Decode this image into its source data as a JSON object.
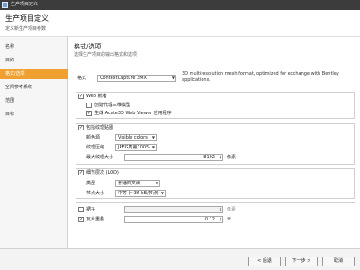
{
  "window": {
    "title": "生产项目定义"
  },
  "header": {
    "title": "生产项目定义",
    "subtitle": "定义新生产项目参数"
  },
  "sidebar": {
    "items": [
      {
        "label": "名称"
      },
      {
        "label": "目的"
      },
      {
        "label": "格式/选项",
        "active": true
      },
      {
        "label": "空间参考系统"
      },
      {
        "label": "范围"
      },
      {
        "label": "目标"
      }
    ]
  },
  "main": {
    "section_title": "格式/选项",
    "section_subtitle": "选择生产项目的输出格式和选项",
    "format": {
      "label": "格式",
      "value": "ContextCapture 3MX",
      "description": "3D multiresolution mesh format, optimized for exchange with Bentley applications."
    },
    "web_ready": {
      "label": "Web 就绪",
      "checked": true,
      "compress_label": "创建代理三维模型",
      "compress_checked": false,
      "viewer_label": "生成 Acute3D Web Viewer 应用程序",
      "viewer_checked": true
    },
    "texture": {
      "label": "包括纹理贴图",
      "checked": true,
      "color_label": "颜色源",
      "color_value": "Visible colors",
      "quality_label": "纹理压缩",
      "quality_value": "JPEG质量100%",
      "max_size_label": "最大纹理大小",
      "max_size_value": "8192",
      "max_size_unit": "像素"
    },
    "lod": {
      "label": "细节层次 (LOD)",
      "checked": true,
      "type_label": "类型",
      "type_value": "普通四叉树",
      "node_label": "节点大小",
      "node_value": "中等 (~36 kB/节点)"
    },
    "skirt": {
      "label": "裙子",
      "checked": false,
      "value": "",
      "unit": "像素"
    },
    "overlap": {
      "label": "瓦片重叠",
      "checked": true,
      "value": "0.12",
      "unit": "米"
    }
  },
  "footer": {
    "back_label": "< 后退",
    "next_label": "下一步 >",
    "cancel_label": "取消"
  }
}
